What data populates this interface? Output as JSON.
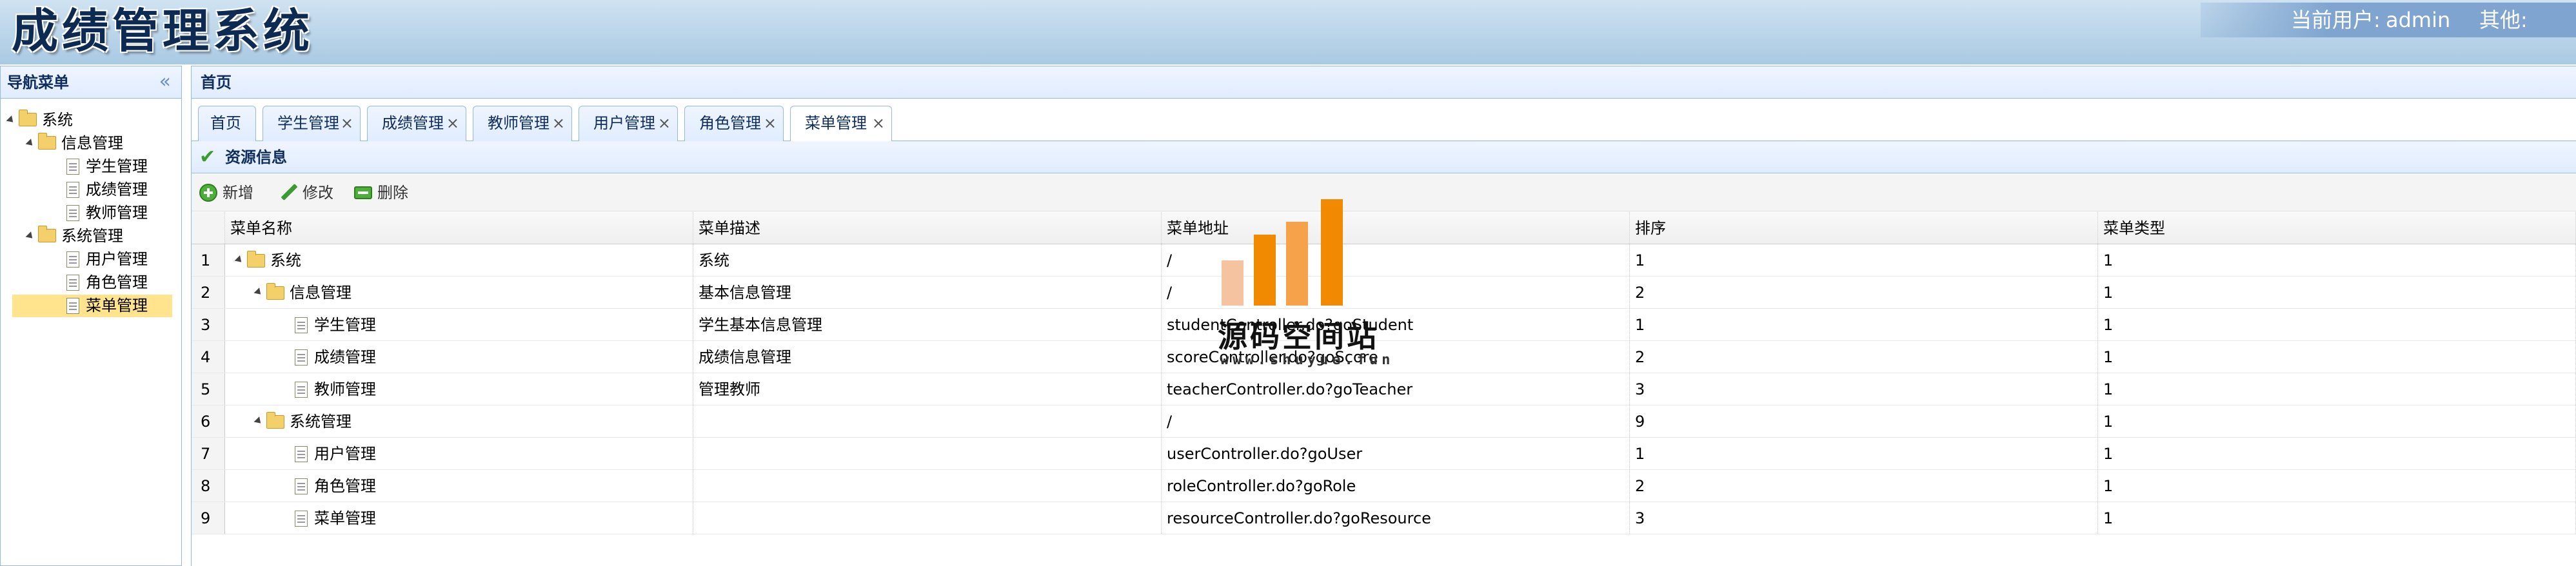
{
  "app": {
    "title": "成绩管理系统",
    "user_label": "当前用户:",
    "user_name": "admin",
    "other_label": "其他:"
  },
  "nav": {
    "title": "导航菜单",
    "collapse_icon": "double-chevron-left-icon",
    "tree": [
      {
        "label": "系统",
        "type": "folder",
        "level": 0,
        "expanded": true
      },
      {
        "label": "信息管理",
        "type": "folder",
        "level": 1,
        "expanded": true
      },
      {
        "label": "学生管理",
        "type": "file",
        "level": 2
      },
      {
        "label": "成绩管理",
        "type": "file",
        "level": 2
      },
      {
        "label": "教师管理",
        "type": "file",
        "level": 2
      },
      {
        "label": "系统管理",
        "type": "folder",
        "level": 1,
        "expanded": true
      },
      {
        "label": "用户管理",
        "type": "file",
        "level": 2
      },
      {
        "label": "角色管理",
        "type": "file",
        "level": 2
      },
      {
        "label": "菜单管理",
        "type": "file",
        "level": 2,
        "selected": true
      }
    ]
  },
  "main": {
    "title": "首页",
    "tabs": [
      {
        "label": "首页",
        "closable": false
      },
      {
        "label": "学生管理",
        "closable": true
      },
      {
        "label": "成绩管理",
        "closable": true
      },
      {
        "label": "教师管理",
        "closable": true
      },
      {
        "label": "用户管理",
        "closable": true
      },
      {
        "label": "角色管理",
        "closable": true
      },
      {
        "label": "菜单管理",
        "closable": true,
        "active": true
      }
    ],
    "close_glyph": "×"
  },
  "panel": {
    "title": "资源信息",
    "toolbar": {
      "add_label": "新增",
      "edit_label": "修改",
      "delete_label": "删除"
    }
  },
  "grid": {
    "columns": [
      "菜单名称",
      "菜单描述",
      "菜单地址",
      "排序",
      "菜单类型"
    ],
    "rows": [
      {
        "num": "1",
        "name": "系统",
        "type": "folder",
        "level": 0,
        "desc": "系统",
        "url": "/",
        "order": "1",
        "menu_type": "1"
      },
      {
        "num": "2",
        "name": "信息管理",
        "type": "folder",
        "level": 1,
        "desc": "基本信息管理",
        "url": "/",
        "order": "2",
        "menu_type": "1"
      },
      {
        "num": "3",
        "name": "学生管理",
        "type": "file",
        "level": 2,
        "desc": "学生基本信息管理",
        "url": "studentController.do?goStudent",
        "order": "1",
        "menu_type": "1"
      },
      {
        "num": "4",
        "name": "成绩管理",
        "type": "file",
        "level": 2,
        "desc": "成绩信息管理",
        "url": "scoreController.do?goScore",
        "order": "2",
        "menu_type": "1"
      },
      {
        "num": "5",
        "name": "教师管理",
        "type": "file",
        "level": 2,
        "desc": "管理教师",
        "url": "teacherController.do?goTeacher",
        "order": "3",
        "menu_type": "1"
      },
      {
        "num": "6",
        "name": "系统管理",
        "type": "folder",
        "level": 1,
        "desc": "",
        "url": "/",
        "order": "9",
        "menu_type": "1"
      },
      {
        "num": "7",
        "name": "用户管理",
        "type": "file",
        "level": 2,
        "desc": "",
        "url": "userController.do?goUser",
        "order": "1",
        "menu_type": "1"
      },
      {
        "num": "8",
        "name": "角色管理",
        "type": "file",
        "level": 2,
        "desc": "",
        "url": "roleController.do?goRole",
        "order": "2",
        "menu_type": "1"
      },
      {
        "num": "9",
        "name": "菜单管理",
        "type": "file",
        "level": 2,
        "desc": "",
        "url": "resourceController.do?goResource",
        "order": "3",
        "menu_type": "1"
      }
    ]
  },
  "watermark": {
    "text": "源码空间站",
    "url": "www.shuyue.fun",
    "color": "#f18a00"
  }
}
